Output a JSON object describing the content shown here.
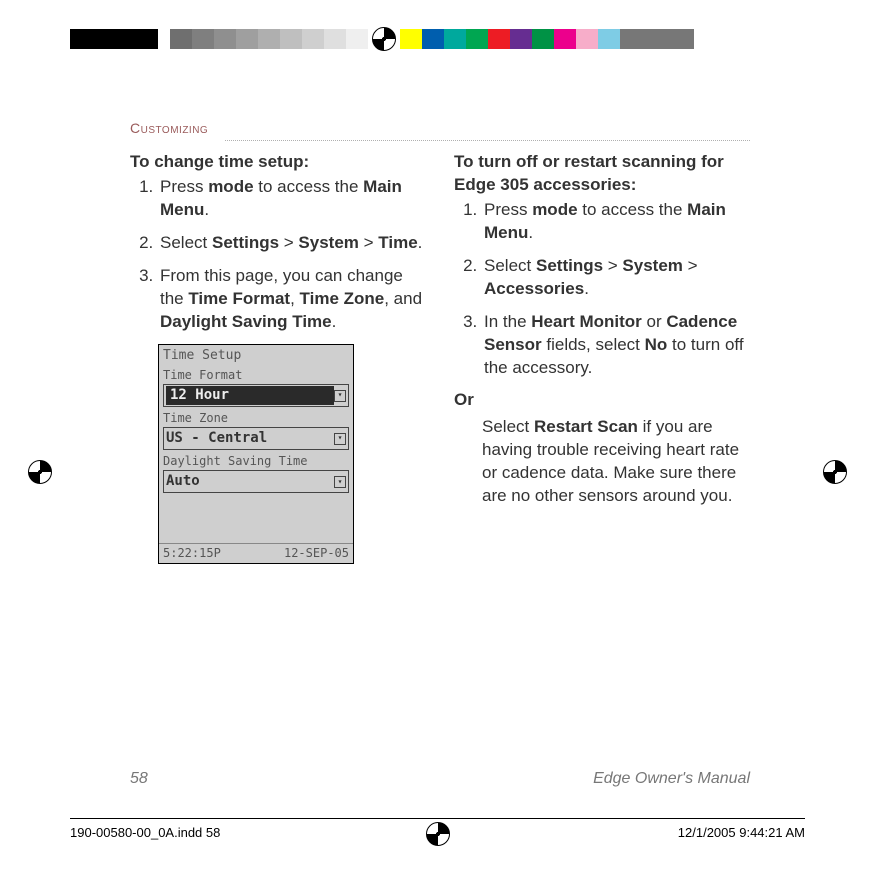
{
  "section": "Customizing",
  "left": {
    "heading": "To change time setup:",
    "steps": [
      {
        "pre": "Press ",
        "b1": "mode",
        "mid": " to access the ",
        "b2": "Main Menu",
        "post": "."
      },
      {
        "pre": "Select ",
        "b1": "Settings",
        "mid": " > ",
        "b2": "System",
        "mid2": " > ",
        "b3": "Time",
        "post": "."
      },
      {
        "pre": "From this page, you can change the ",
        "b1": "Time Format",
        "mid": ", ",
        "b2": "Time Zone",
        "mid2": ", and ",
        "b3": "Daylight Saving Time",
        "post": "."
      }
    ]
  },
  "right": {
    "heading": "To turn off or restart scanning for Edge 305 accessories:",
    "steps": [
      {
        "pre": "Press ",
        "b1": "mode",
        "mid": " to access the ",
        "b2": "Main Menu",
        "post": "."
      },
      {
        "pre": "Select ",
        "b1": "Settings",
        "mid": " > ",
        "b2": "System",
        "mid2": " > ",
        "b3": "Accessories",
        "post": "."
      },
      {
        "pre": "In the ",
        "b1": "Heart Monitor",
        "mid": " or ",
        "b2": "Cadence Sensor",
        "mid2": " fields, select ",
        "b3": "No",
        "post": " to turn off the accessory."
      }
    ],
    "or": "Or",
    "alt": {
      "pre": "Select ",
      "b1": "Restart Scan",
      "post": " if you are having trouble receiving heart rate or cadence data. Make sure there are no other sensors around you."
    }
  },
  "device": {
    "title": "Time Setup",
    "label1": "Time Format",
    "val1": "12 Hour",
    "label2": "Time Zone",
    "val2": "US - Central",
    "label3": "Daylight Saving Time",
    "val3": "Auto",
    "time": "5:22:15P",
    "date": "12-SEP-05"
  },
  "footer": {
    "page": "58",
    "doc": "Edge Owner's Manual"
  },
  "printline": {
    "left": "190-00580-00_0A.indd   58",
    "right": "12/1/2005   9:44:21 AM"
  }
}
